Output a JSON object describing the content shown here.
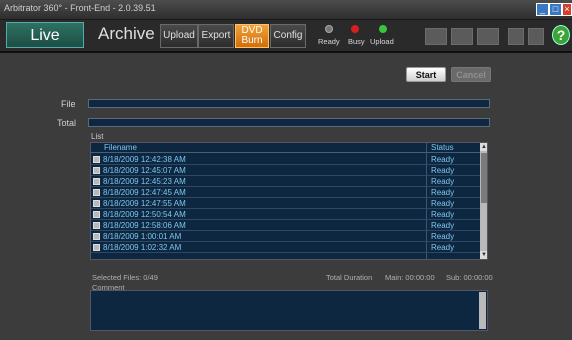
{
  "window": {
    "title": "Arbitrator 360° - Front-End - 2.0.39.51"
  },
  "nav": {
    "live": "Live",
    "archive": "Archive",
    "upload": "Upload",
    "export": "Export",
    "dvd_burn_line1": "DVD",
    "dvd_burn_line2": "Burn",
    "config": "Config"
  },
  "status": {
    "ready": "Ready",
    "busy": "Busy",
    "upload": "Upload"
  },
  "help": "?",
  "actions": {
    "start": "Start",
    "cancel": "Cancel"
  },
  "labels": {
    "file": "File",
    "total": "Total",
    "list": "List",
    "comment": "Comment"
  },
  "list": {
    "headers": {
      "filename": "Filename",
      "status": "Status"
    },
    "rows": [
      {
        "filename": "8/18/2009 12:42:38 AM",
        "status": "Ready"
      },
      {
        "filename": "8/18/2009 12:45:07 AM",
        "status": "Ready"
      },
      {
        "filename": "8/18/2009 12:45:23 AM",
        "status": "Ready"
      },
      {
        "filename": "8/18/2009 12:47:45 AM",
        "status": "Ready"
      },
      {
        "filename": "8/18/2009 12:47:55 AM",
        "status": "Ready"
      },
      {
        "filename": "8/18/2009 12:50:54 AM",
        "status": "Ready"
      },
      {
        "filename": "8/18/2009 12:58:06 AM",
        "status": "Ready"
      },
      {
        "filename": "8/18/2009 1:00:01 AM",
        "status": "Ready"
      },
      {
        "filename": "8/18/2009 1:02:32 AM",
        "status": "Ready"
      }
    ]
  },
  "footer": {
    "selected_files": "Selected Files: 0/49",
    "total_duration": "Total Duration",
    "main": "Main: 00:00:00",
    "sub": "Sub: 00:00:00"
  },
  "colors": {
    "accent": "#e68a1c",
    "live_tab": "#2a6759",
    "list_bg": "#0e2740",
    "list_text": "#7fc6f0"
  }
}
